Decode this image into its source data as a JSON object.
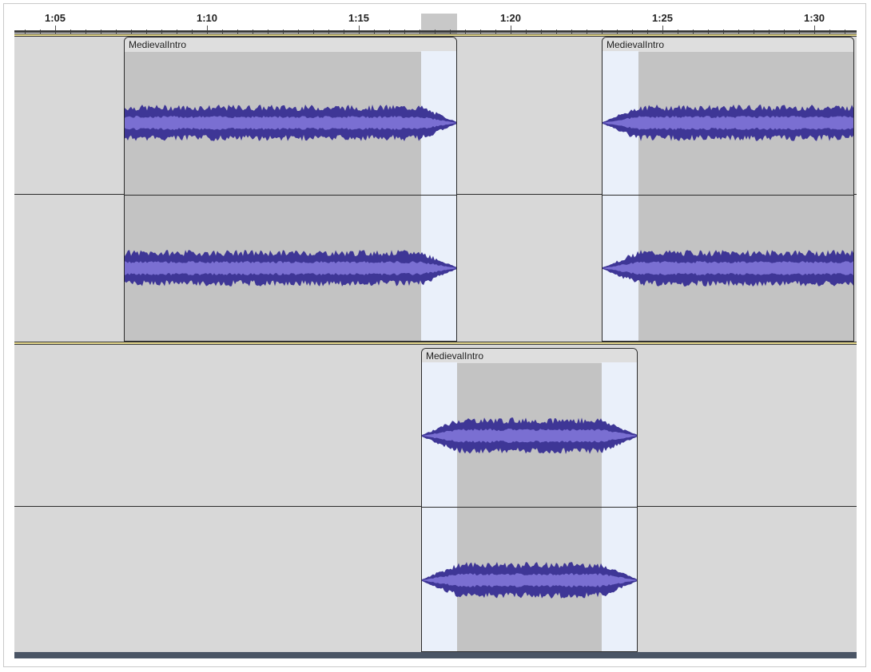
{
  "ruler": {
    "labels": [
      "1:05",
      "1:10",
      "1:15",
      "1:20",
      "1:25",
      "1:30"
    ]
  },
  "tracks": [
    {
      "clips": [
        {
          "name": "MedievalIntro"
        },
        {
          "name": "MedievalIntro"
        }
      ]
    },
    {
      "clips": [
        {
          "name": "MedievalIntro"
        }
      ]
    }
  ],
  "colors": {
    "track_background": "#d8d8d8",
    "clip_background": "#c3c3c3",
    "overlap_highlight": "#eaf0fa",
    "waveform_outer": "#3e3696",
    "waveform_inner": "#7a6fd2",
    "track_separator": "#e2d58a"
  }
}
